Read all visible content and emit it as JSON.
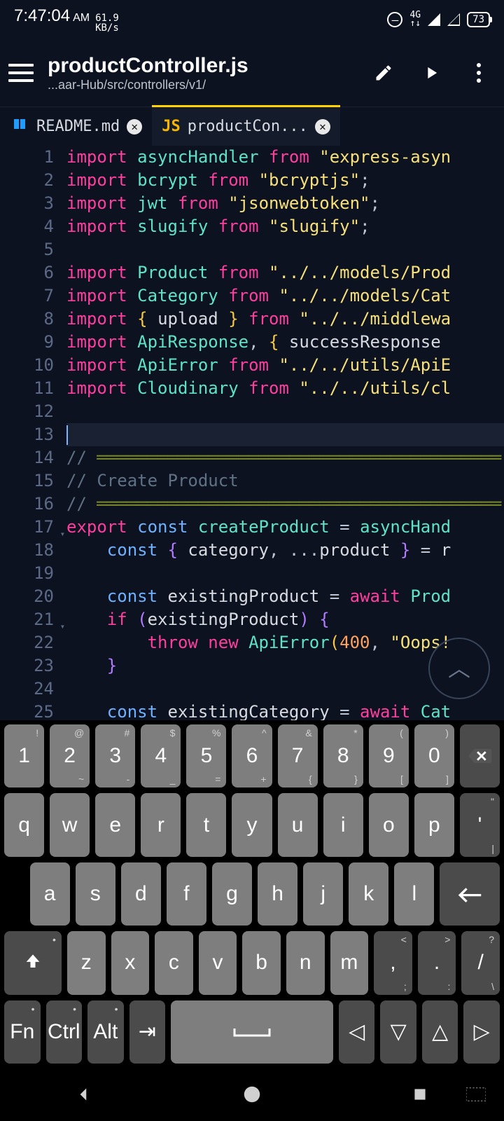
{
  "status": {
    "time": "7:47:04",
    "ampm": "AM",
    "net_speed_top": "61.9",
    "net_speed_bot": "KB/s",
    "net_type": "4G",
    "battery": "73"
  },
  "header": {
    "title": "productController.js",
    "subtitle": "...aar-Hub/src/controllers/v1/"
  },
  "tabs": [
    {
      "label": "README.md",
      "icon": "book",
      "active": false
    },
    {
      "label": "productCon...",
      "icon": "js",
      "active": true
    }
  ],
  "code": {
    "lines": [
      {
        "n": 1,
        "t": [
          [
            "kw",
            "import"
          ],
          [
            "sp",
            " "
          ],
          [
            "ident",
            "asyncHandler"
          ],
          [
            "sp",
            " "
          ],
          [
            "from",
            "from"
          ],
          [
            "sp",
            " "
          ],
          [
            "str",
            "\"express-asyn"
          ]
        ]
      },
      {
        "n": 2,
        "t": [
          [
            "kw",
            "import"
          ],
          [
            "sp",
            " "
          ],
          [
            "ident",
            "bcrypt"
          ],
          [
            "sp",
            " "
          ],
          [
            "from",
            "from"
          ],
          [
            "sp",
            " "
          ],
          [
            "str",
            "\"bcryptjs\""
          ],
          [
            "punc",
            ";"
          ]
        ]
      },
      {
        "n": 3,
        "t": [
          [
            "kw",
            "import"
          ],
          [
            "sp",
            " "
          ],
          [
            "ident",
            "jwt"
          ],
          [
            "sp",
            " "
          ],
          [
            "from",
            "from"
          ],
          [
            "sp",
            " "
          ],
          [
            "str",
            "\"jsonwebtoken\""
          ],
          [
            "punc",
            ";"
          ]
        ]
      },
      {
        "n": 4,
        "t": [
          [
            "kw",
            "import"
          ],
          [
            "sp",
            " "
          ],
          [
            "ident",
            "slugify"
          ],
          [
            "sp",
            " "
          ],
          [
            "from",
            "from"
          ],
          [
            "sp",
            " "
          ],
          [
            "str",
            "\"slugify\""
          ],
          [
            "punc",
            ";"
          ]
        ]
      },
      {
        "n": 5,
        "t": []
      },
      {
        "n": 6,
        "t": [
          [
            "kw",
            "import"
          ],
          [
            "sp",
            " "
          ],
          [
            "ident",
            "Product"
          ],
          [
            "sp",
            " "
          ],
          [
            "from",
            "from"
          ],
          [
            "sp",
            " "
          ],
          [
            "str",
            "\"../../models/Prod"
          ]
        ]
      },
      {
        "n": 7,
        "t": [
          [
            "kw",
            "import"
          ],
          [
            "sp",
            " "
          ],
          [
            "ident",
            "Category"
          ],
          [
            "sp",
            " "
          ],
          [
            "from",
            "from"
          ],
          [
            "sp",
            " "
          ],
          [
            "str",
            "\"../../models/Cat"
          ]
        ]
      },
      {
        "n": 8,
        "t": [
          [
            "kw",
            "import"
          ],
          [
            "sp",
            " "
          ],
          [
            "brace",
            "{"
          ],
          [
            "sp",
            " "
          ],
          [
            "id2",
            "upload"
          ],
          [
            "sp",
            " "
          ],
          [
            "brace",
            "}"
          ],
          [
            "sp",
            " "
          ],
          [
            "from",
            "from"
          ],
          [
            "sp",
            " "
          ],
          [
            "str",
            "\"../../middlewa"
          ]
        ]
      },
      {
        "n": 9,
        "t": [
          [
            "kw",
            "import"
          ],
          [
            "sp",
            " "
          ],
          [
            "ident",
            "ApiResponse"
          ],
          [
            "punc",
            ","
          ],
          [
            "sp",
            " "
          ],
          [
            "brace",
            "{"
          ],
          [
            "sp",
            " "
          ],
          [
            "id2",
            "successResponse"
          ],
          [
            "sp",
            " "
          ]
        ]
      },
      {
        "n": 10,
        "t": [
          [
            "kw",
            "import"
          ],
          [
            "sp",
            " "
          ],
          [
            "ident",
            "ApiError"
          ],
          [
            "sp",
            " "
          ],
          [
            "from",
            "from"
          ],
          [
            "sp",
            " "
          ],
          [
            "str",
            "\"../../utils/ApiE"
          ]
        ]
      },
      {
        "n": 11,
        "t": [
          [
            "kw",
            "import"
          ],
          [
            "sp",
            " "
          ],
          [
            "ident",
            "Cloudinary"
          ],
          [
            "sp",
            " "
          ],
          [
            "from",
            "from"
          ],
          [
            "sp",
            " "
          ],
          [
            "str",
            "\"../../utils/cl"
          ]
        ]
      },
      {
        "n": 12,
        "t": []
      },
      {
        "n": 13,
        "cursor": true,
        "t": []
      },
      {
        "n": 14,
        "t": [
          [
            "cmt",
            "//"
          ],
          [
            "sp",
            " "
          ],
          [
            "cmtrule",
            ""
          ]
        ]
      },
      {
        "n": 15,
        "t": [
          [
            "cmt",
            "// Create Product"
          ]
        ]
      },
      {
        "n": 16,
        "t": [
          [
            "cmt",
            "//"
          ],
          [
            "sp",
            " "
          ],
          [
            "cmtrule",
            ""
          ]
        ]
      },
      {
        "n": 17,
        "fold": true,
        "t": [
          [
            "kw",
            "export"
          ],
          [
            "sp",
            " "
          ],
          [
            "kw2",
            "const"
          ],
          [
            "sp",
            " "
          ],
          [
            "fn",
            "createProduct"
          ],
          [
            "sp",
            " "
          ],
          [
            "punc",
            "="
          ],
          [
            "sp",
            " "
          ],
          [
            "fn",
            "asyncHand"
          ]
        ]
      },
      {
        "n": 18,
        "t": [
          [
            "guide",
            "    "
          ],
          [
            "kw2",
            "const"
          ],
          [
            "sp",
            " "
          ],
          [
            "br2",
            "{"
          ],
          [
            "sp",
            " "
          ],
          [
            "id2",
            "category"
          ],
          [
            "punc",
            ","
          ],
          [
            "sp",
            " "
          ],
          [
            "punc",
            "..."
          ],
          [
            "id2",
            "product"
          ],
          [
            "sp",
            " "
          ],
          [
            "br2",
            "}"
          ],
          [
            "sp",
            " "
          ],
          [
            "punc",
            "="
          ],
          [
            "sp",
            " "
          ],
          [
            "id2",
            "r"
          ]
        ]
      },
      {
        "n": 19,
        "t": []
      },
      {
        "n": 20,
        "t": [
          [
            "guide",
            "    "
          ],
          [
            "kw2",
            "const"
          ],
          [
            "sp",
            " "
          ],
          [
            "id2",
            "existingProduct"
          ],
          [
            "sp",
            " "
          ],
          [
            "punc",
            "="
          ],
          [
            "sp",
            " "
          ],
          [
            "kw",
            "await"
          ],
          [
            "sp",
            " "
          ],
          [
            "ident",
            "Prod"
          ]
        ]
      },
      {
        "n": 21,
        "fold": true,
        "t": [
          [
            "guide",
            "    "
          ],
          [
            "kw",
            "if"
          ],
          [
            "sp",
            " "
          ],
          [
            "br2",
            "("
          ],
          [
            "id2",
            "existingProduct"
          ],
          [
            "br2",
            ")"
          ],
          [
            "sp",
            " "
          ],
          [
            "br2",
            "{"
          ]
        ]
      },
      {
        "n": 22,
        "t": [
          [
            "guide",
            "        "
          ],
          [
            "kw",
            "throw"
          ],
          [
            "sp",
            " "
          ],
          [
            "kw",
            "new"
          ],
          [
            "sp",
            " "
          ],
          [
            "fn",
            "ApiError"
          ],
          [
            "brace",
            "("
          ],
          [
            "num",
            "400"
          ],
          [
            "punc",
            ","
          ],
          [
            "sp",
            " "
          ],
          [
            "str",
            "\"Oops!"
          ]
        ]
      },
      {
        "n": 23,
        "t": [
          [
            "guide",
            "    "
          ],
          [
            "br2",
            "}"
          ]
        ]
      },
      {
        "n": 24,
        "t": []
      },
      {
        "n": 25,
        "t": [
          [
            "guide",
            "    "
          ],
          [
            "kw2",
            "const"
          ],
          [
            "sp",
            " "
          ],
          [
            "id2",
            "existingCategory"
          ],
          [
            "sp",
            " "
          ],
          [
            "punc",
            "="
          ],
          [
            "sp",
            " "
          ],
          [
            "kw",
            "await"
          ],
          [
            "sp",
            " "
          ],
          [
            "ident",
            "Cat"
          ]
        ]
      }
    ]
  },
  "keyboard": {
    "row1": [
      {
        "m": "1",
        "a": "!"
      },
      {
        "m": "2",
        "a": "@",
        "b": "~"
      },
      {
        "m": "3",
        "a": "#",
        "b": "-"
      },
      {
        "m": "4",
        "a": "$",
        "b": "_"
      },
      {
        "m": "5",
        "a": "%",
        "b": "="
      },
      {
        "m": "6",
        "a": "^",
        "b": "+"
      },
      {
        "m": "7",
        "a": "&",
        "b": "{"
      },
      {
        "m": "8",
        "a": "*",
        "b": "}"
      },
      {
        "m": "9",
        "a": "(",
        "b": "["
      },
      {
        "m": "0",
        "a": ")",
        "b": "]"
      }
    ],
    "row2": [
      "q",
      "w",
      "e",
      "r",
      "t",
      "y",
      "u",
      "i",
      "o",
      "p"
    ],
    "row2_last": {
      "m": "'",
      "a": "\"",
      "b": "|"
    },
    "row3": [
      "a",
      "s",
      "d",
      "f",
      "g",
      "h",
      "j",
      "k",
      "l"
    ],
    "row4": [
      "z",
      "x",
      "c",
      "v",
      "b",
      "n",
      "m"
    ],
    "row4_punc": [
      {
        "m": ",",
        "a": "<",
        "b": ";"
      },
      {
        "m": ".",
        "a": ">",
        "b": ":"
      },
      {
        "m": "/",
        "a": "?",
        "b": "\\"
      }
    ],
    "row5": {
      "fn": "Fn",
      "ctrl": "Ctrl",
      "alt": "Alt"
    }
  }
}
